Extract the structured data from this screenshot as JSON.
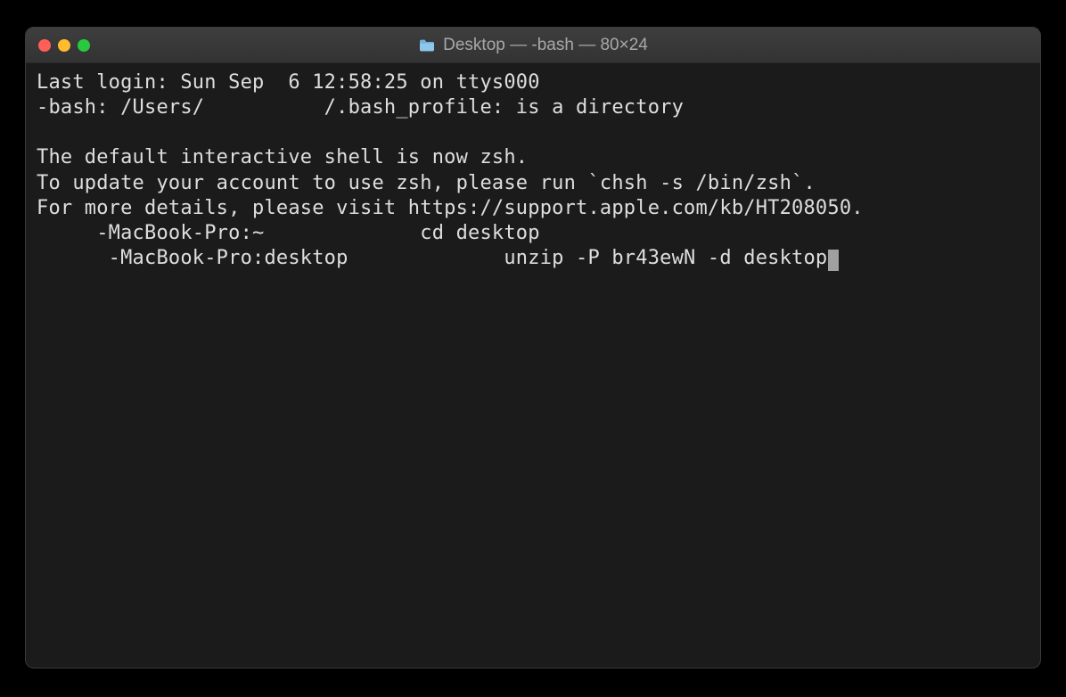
{
  "window": {
    "title": "Desktop — -bash — 80×24",
    "folderIconName": "folder-icon"
  },
  "terminal": {
    "lines": [
      "Last login: Sun Sep  6 12:58:25 on ttys000",
      "-bash: /Users/          /.bash_profile: is a directory",
      "",
      "The default interactive shell is now zsh.",
      "To update your account to use zsh, please run `chsh -s /bin/zsh`.",
      "For more details, please visit https://support.apple.com/kb/HT208050.",
      "     -MacBook-Pro:~             cd desktop",
      "      -MacBook-Pro:desktop             unzip -P br43ewN -d desktop"
    ]
  }
}
